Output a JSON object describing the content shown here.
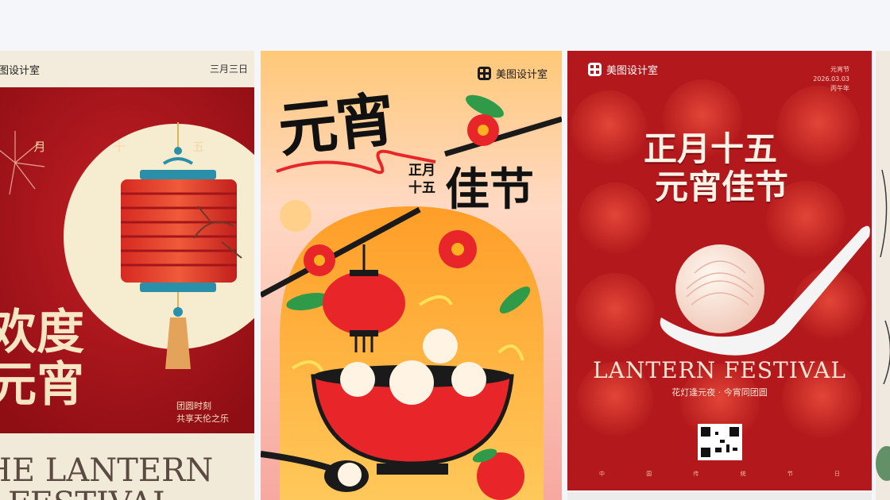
{
  "poster1": {
    "brand": "图设计室",
    "date": "三月三日",
    "top_chars": [
      "月",
      "十",
      "五"
    ],
    "title_line1": "欢度",
    "title_line2": "元宵",
    "sub_line1": "团圆时刻",
    "sub_line2": "共享天伦之乐",
    "en_line1": "HE LANTERN",
    "en_line2": "FESTIVAL"
  },
  "poster2": {
    "brand": "美图设计室",
    "title_big": "元宵",
    "side_small_1": "正月",
    "side_small_2": "十五",
    "title_big_2": "佳节"
  },
  "poster3": {
    "brand": "美图设计室",
    "corner_line1": "元宵节",
    "corner_line2": "2026.03.03",
    "corner_line3": "丙午年",
    "title_line1": "正月十五",
    "title_line2": "元宵佳节",
    "en_title": "LANTERN FESTIVAL",
    "sub_title": "花灯逢元夜 · 今宵同团圆",
    "footer_chars": [
      "中",
      "国",
      "传",
      "统",
      "节",
      "日"
    ]
  },
  "colors": {
    "page_bg": "#f4f6fa",
    "festival_red": "#b3191c",
    "poster2_orange": "#ffc07a"
  }
}
